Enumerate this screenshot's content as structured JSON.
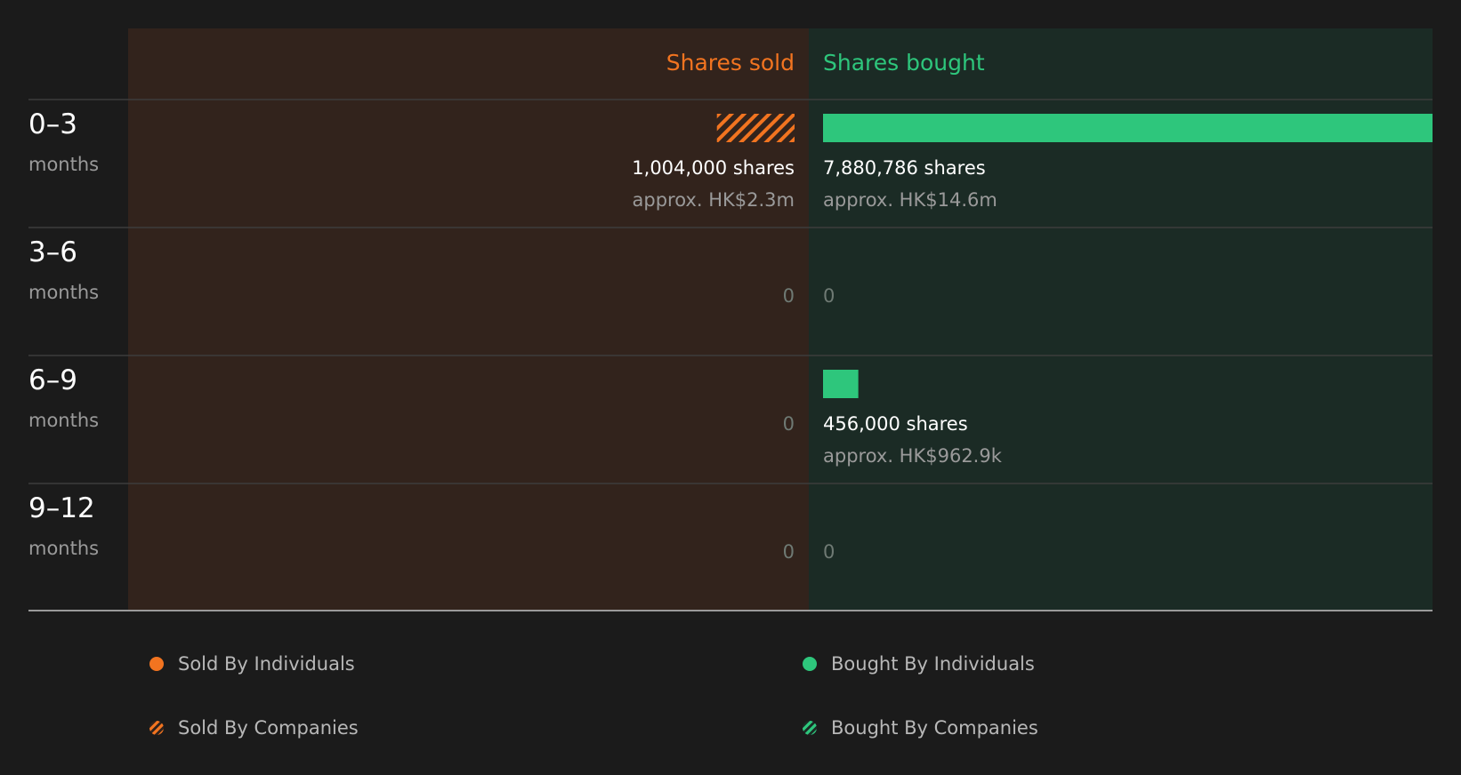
{
  "colors": {
    "background": "#1b1b1b",
    "sold_panel": "#32231c",
    "bought_panel": "#1b2b25",
    "sold_accent": "#f27420",
    "bought_accent": "#2ec67c",
    "value_text": "#ffffff",
    "sub_text": "#9a9a9a",
    "zero_text": "#6f7a74",
    "divider": "#3c3c3c",
    "axis": "#9a9a9a"
  },
  "chart_data": {
    "type": "bar",
    "orientation": "horizontal-diverging",
    "headers": {
      "sold": "Shares sold",
      "bought": "Shares bought"
    },
    "rows": [
      {
        "range": "0–3",
        "unit": "months",
        "sold": {
          "shares": 1004000,
          "shares_label": "1,004,000 shares",
          "value_label": "approx. HK$2.3m",
          "by": "companies"
        },
        "bought": {
          "shares": 7880786,
          "shares_label": "7,880,786 shares",
          "value_label": "approx. HK$14.6m",
          "by": "individuals"
        }
      },
      {
        "range": "3–6",
        "unit": "months",
        "sold": {
          "shares": 0,
          "shares_label": "0",
          "value_label": "",
          "by": ""
        },
        "bought": {
          "shares": 0,
          "shares_label": "0",
          "value_label": "",
          "by": ""
        }
      },
      {
        "range": "6–9",
        "unit": "months",
        "sold": {
          "shares": 0,
          "shares_label": "0",
          "value_label": "",
          "by": ""
        },
        "bought": {
          "shares": 456000,
          "shares_label": "456,000 shares",
          "value_label": "approx. HK$962.9k",
          "by": "individuals"
        }
      },
      {
        "range": "9–12",
        "unit": "months",
        "sold": {
          "shares": 0,
          "shares_label": "0",
          "value_label": "",
          "by": ""
        },
        "bought": {
          "shares": 0,
          "shares_label": "0",
          "value_label": "",
          "by": ""
        }
      }
    ],
    "max_shares": 7880786,
    "legend": [
      {
        "label": "Sold By Individuals",
        "side": "sold",
        "pattern": "solid"
      },
      {
        "label": "Bought By Individuals",
        "side": "bought",
        "pattern": "solid"
      },
      {
        "label": "Sold By Companies",
        "side": "sold",
        "pattern": "hatched"
      },
      {
        "label": "Bought By Companies",
        "side": "bought",
        "pattern": "hatched"
      }
    ]
  }
}
